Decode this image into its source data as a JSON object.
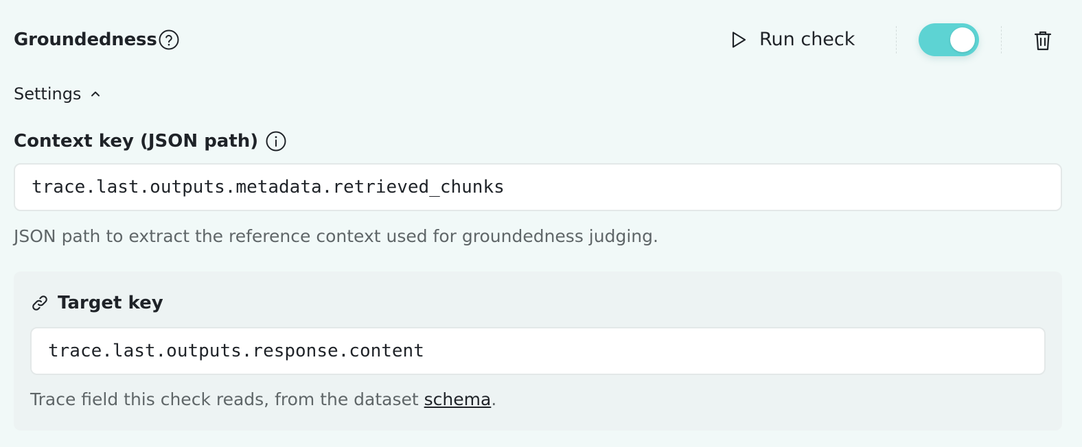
{
  "header": {
    "title": "Groundedness",
    "help_icon": "question-circle-icon",
    "run_check_label": "Run check",
    "run_icon": "play-icon",
    "enabled": true,
    "delete_icon": "trash-icon",
    "accent_color": "#5dd3d3"
  },
  "settings": {
    "label": "Settings",
    "expanded": true,
    "chevron_icon": "chevron-up-icon"
  },
  "context_key": {
    "label": "Context key (JSON path)",
    "info_icon": "info-circle-icon",
    "value": "trace.last.outputs.metadata.retrieved_chunks",
    "help_text": "JSON path to extract the reference context used for groundedness judging."
  },
  "target_key": {
    "label": "Target key",
    "link_icon": "link-icon",
    "value": "trace.last.outputs.response.content",
    "help_prefix": "Trace field this check reads, from the dataset ",
    "help_link": "schema",
    "help_suffix": "."
  }
}
